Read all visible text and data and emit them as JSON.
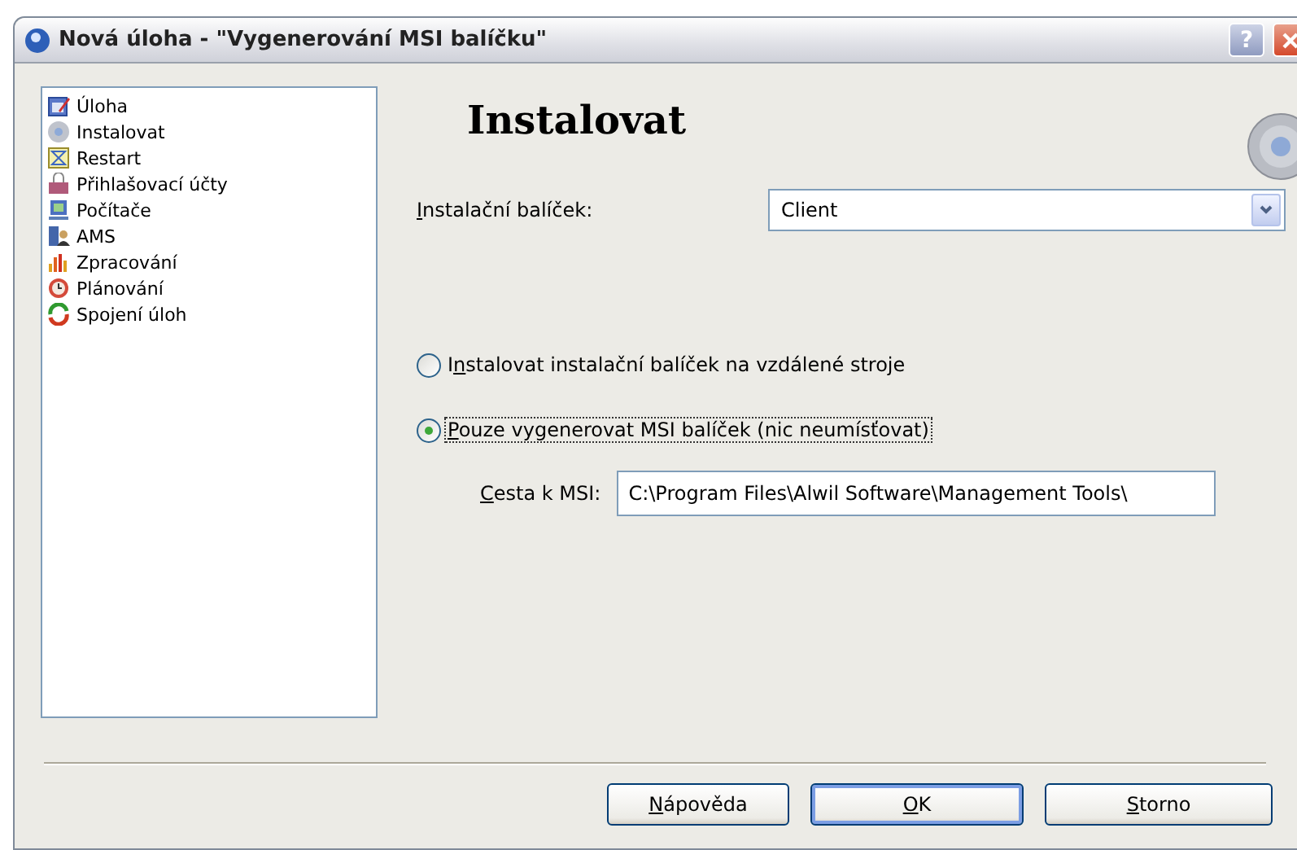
{
  "window": {
    "title": "Nová úloha - \"Vygenerování MSI balíčku\"",
    "help_button": "?"
  },
  "sidebar": {
    "items": [
      {
        "label": "Úloha"
      },
      {
        "label": "Instalovat"
      },
      {
        "label": "Restart"
      },
      {
        "label": "Přihlašovací účty"
      },
      {
        "label": "Počítače"
      },
      {
        "label": "AMS"
      },
      {
        "label": "Zpracování"
      },
      {
        "label": "Plánování"
      },
      {
        "label": "Spojení úloh"
      }
    ]
  },
  "page": {
    "heading": "Instalovat",
    "package": {
      "label": "Instalační balíček:",
      "value": "Client"
    },
    "options": [
      {
        "label": "Instalovat instalační balíček na vzdálené stroje",
        "selected": false,
        "focused": false
      },
      {
        "label": "Pouze vygenerovat MSI balíček (nic neumísťovat)",
        "selected": true,
        "focused": true
      }
    ],
    "msi_path": {
      "label": "Cesta k MSI:",
      "value": "C:\\Program Files\\Alwil Software\\Management Tools\\"
    }
  },
  "buttons": [
    {
      "label": "Nápověda",
      "default": false
    },
    {
      "label": "OK",
      "default": true
    },
    {
      "label": "Storno",
      "default": false
    }
  ]
}
